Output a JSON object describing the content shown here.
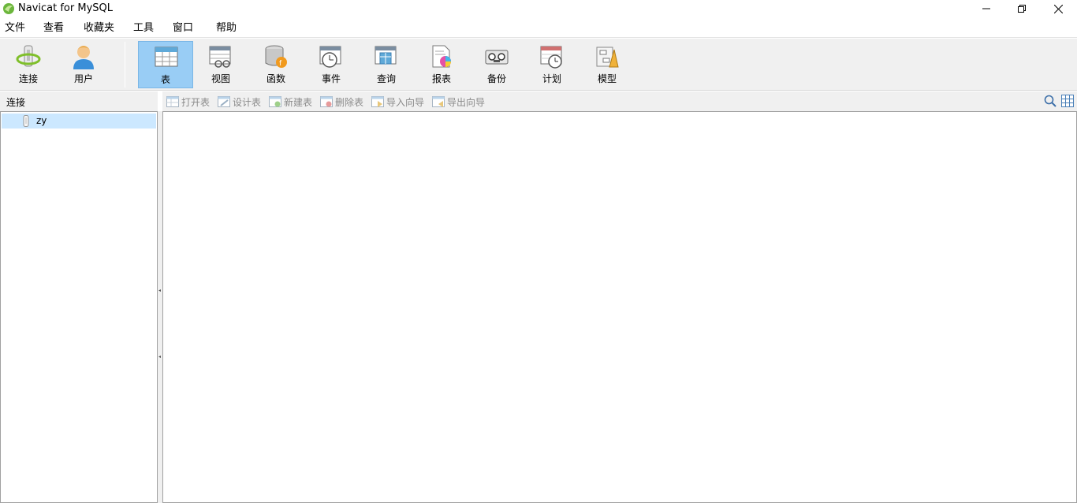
{
  "window": {
    "title": "Navicat for MySQL"
  },
  "menubar": {
    "items": [
      "文件",
      "查看",
      "收藏夹",
      "工具",
      "窗口",
      "帮助"
    ]
  },
  "toolbar": {
    "connect": "连接",
    "user": "用户",
    "table": "表",
    "view": "视图",
    "function": "函数",
    "event": "事件",
    "query": "查询",
    "report": "报表",
    "backup": "备份",
    "schedule": "计划",
    "model": "模型",
    "active": "表"
  },
  "connections": {
    "title": "连接",
    "items": [
      {
        "label": "zy",
        "selected": true
      }
    ]
  },
  "object_toolbar": {
    "open_table": "打开表",
    "design_table": "设计表",
    "new_table": "新建表",
    "delete_table": "删除表",
    "import_wizard": "导入向导",
    "export_wizard": "导出向导"
  },
  "icons": [
    "navicat-logo-icon",
    "minimize-icon",
    "restore-icon",
    "close-icon",
    "search-icon",
    "grid-view-icon"
  ]
}
